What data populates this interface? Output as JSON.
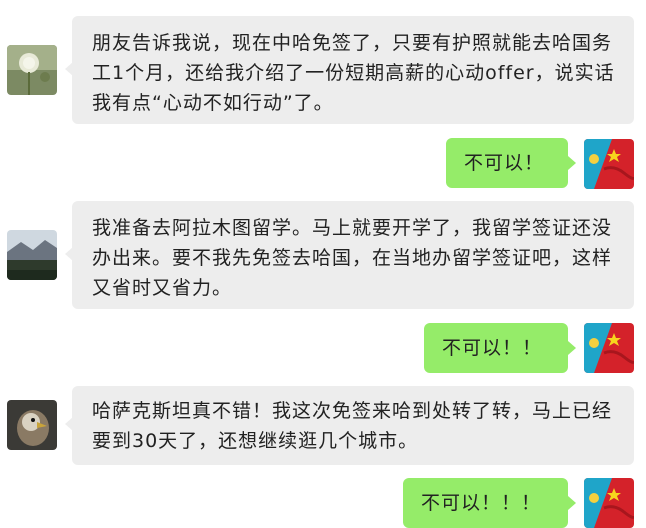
{
  "messages": [
    {
      "side": "left",
      "avatar_icon": "dandelion-avatar-icon",
      "text": "朋友告诉我说，现在中哈免签了，只要有护照就能去哈国务工1个月，还给我介绍了一份短期高薪的心动offer，说实话我有点“心动不如行动”了。"
    },
    {
      "side": "right",
      "avatar_icon": "flags-avatar-icon",
      "text": "不可以！"
    },
    {
      "side": "left",
      "avatar_icon": "mountain-avatar-icon",
      "text": "我准备去阿拉木图留学。马上就要开学了，我留学签证还没办出来。要不我先免签去哈国，在当地办留学签证吧，这样又省时又省力。"
    },
    {
      "side": "right",
      "avatar_icon": "flags-avatar-icon",
      "text": "不可以！！"
    },
    {
      "side": "left",
      "avatar_icon": "eagle-avatar-icon",
      "text": "哈萨克斯坦真不错！我这次免签来哈到处转了转，马上已经要到30天了，还想继续逛几个城市。"
    },
    {
      "side": "right",
      "avatar_icon": "flags-avatar-icon",
      "text": "不可以！！！"
    }
  ],
  "colors": {
    "left_bubble": "#ededed",
    "right_bubble": "#95ec69",
    "text": "#222222"
  }
}
